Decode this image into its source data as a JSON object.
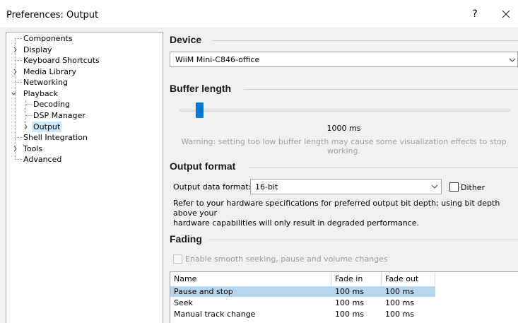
{
  "window": {
    "title": "Preferences: Output",
    "help_glyph": "?",
    "close_glyph": "×"
  },
  "tree": {
    "items": [
      {
        "label": "Components"
      },
      {
        "label": "Display"
      },
      {
        "label": "Keyboard Shortcuts"
      },
      {
        "label": "Media Library"
      },
      {
        "label": "Networking"
      },
      {
        "label": "Playback"
      },
      {
        "label": "Decoding"
      },
      {
        "label": "DSP Manager"
      },
      {
        "label": "Output",
        "selected": true
      },
      {
        "label": "Shell Integration"
      },
      {
        "label": "Tools"
      },
      {
        "label": "Advanced"
      }
    ]
  },
  "device": {
    "section_title": "Device",
    "selected": "WiiM Mini-C846-office"
  },
  "buffer": {
    "section_title": "Buffer length",
    "value_text": "1000 ms",
    "warning": "Warning: setting too low buffer length may cause some visualization effects to stop working.",
    "slider_fraction": 0.06
  },
  "output_format": {
    "section_title": "Output format",
    "label": "Output data format:",
    "selected": "16-bit",
    "dither_label": "Dither",
    "dither_checked": false,
    "info_line1": "Refer to your hardware specifications for preferred output bit depth; using bit depth above your",
    "info_line2": "hardware capabilities will only result in degraded performance."
  },
  "fading": {
    "section_title": "Fading",
    "smooth_label": "Enable smooth seeking, pause and volume changes",
    "smooth_checked": false,
    "columns": [
      "Name",
      "Fade in",
      "Fade out"
    ],
    "rows": [
      {
        "name": "Pause and stop",
        "fade_in": "100 ms",
        "fade_out": "100 ms",
        "selected": true
      },
      {
        "name": "Seek",
        "fade_in": "100 ms",
        "fade_out": "100 ms"
      },
      {
        "name": "Manual track change",
        "fade_in": "100 ms",
        "fade_out": "100 ms"
      }
    ]
  },
  "colors": {
    "accent": "#0078d7",
    "selection": "#cce8ff",
    "row_selection": "#b8d7ee"
  }
}
